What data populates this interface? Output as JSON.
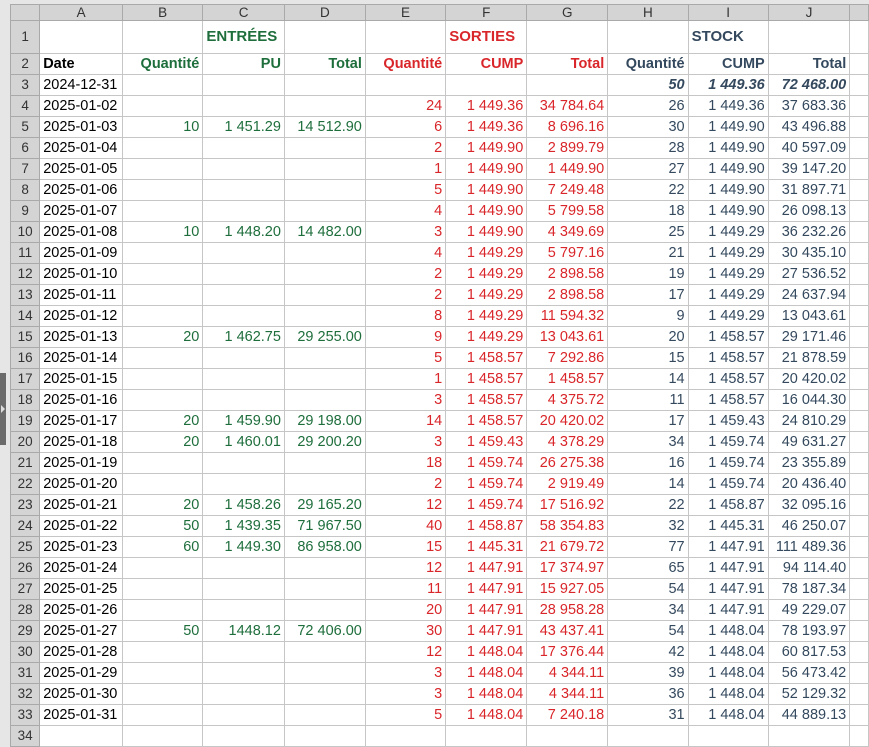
{
  "columns": [
    "A",
    "B",
    "C",
    "D",
    "E",
    "F",
    "G",
    "H",
    "I",
    "J",
    ""
  ],
  "colors": {
    "entrees": "#1e6e3c",
    "sorties": "#d9262a",
    "stock": "#34495e"
  },
  "sections": {
    "entrees": "ENTRÉES",
    "sorties": "SORTIES",
    "stock": "STOCK"
  },
  "headers": [
    "Date",
    "Quantité",
    "PU",
    "Total",
    "Quantité",
    "CUMP",
    "Total",
    "Quantité",
    "CUMP",
    "Total"
  ],
  "rows": [
    [
      "2024-12-31",
      "",
      "",
      "",
      "",
      "",
      "",
      "50",
      "1 449.36",
      "72 468.00"
    ],
    [
      "2025-01-02",
      "",
      "",
      "",
      "24",
      "1 449.36",
      "34 784.64",
      "26",
      "1 449.36",
      "37 683.36"
    ],
    [
      "2025-01-03",
      "10",
      "1 451.29",
      "14 512.90",
      "6",
      "1 449.36",
      "8 696.16",
      "30",
      "1 449.90",
      "43 496.88"
    ],
    [
      "2025-01-04",
      "",
      "",
      "",
      "2",
      "1 449.90",
      "2 899.79",
      "28",
      "1 449.90",
      "40 597.09"
    ],
    [
      "2025-01-05",
      "",
      "",
      "",
      "1",
      "1 449.90",
      "1 449.90",
      "27",
      "1 449.90",
      "39 147.20"
    ],
    [
      "2025-01-06",
      "",
      "",
      "",
      "5",
      "1 449.90",
      "7 249.48",
      "22",
      "1 449.90",
      "31 897.71"
    ],
    [
      "2025-01-07",
      "",
      "",
      "",
      "4",
      "1 449.90",
      "5 799.58",
      "18",
      "1 449.90",
      "26 098.13"
    ],
    [
      "2025-01-08",
      "10",
      "1 448.20",
      "14 482.00",
      "3",
      "1 449.90",
      "4 349.69",
      "25",
      "1 449.29",
      "36 232.26"
    ],
    [
      "2025-01-09",
      "",
      "",
      "",
      "4",
      "1 449.29",
      "5 797.16",
      "21",
      "1 449.29",
      "30 435.10"
    ],
    [
      "2025-01-10",
      "",
      "",
      "",
      "2",
      "1 449.29",
      "2 898.58",
      "19",
      "1 449.29",
      "27 536.52"
    ],
    [
      "2025-01-11",
      "",
      "",
      "",
      "2",
      "1 449.29",
      "2 898.58",
      "17",
      "1 449.29",
      "24 637.94"
    ],
    [
      "2025-01-12",
      "",
      "",
      "",
      "8",
      "1 449.29",
      "11 594.32",
      "9",
      "1 449.29",
      "13 043.61"
    ],
    [
      "2025-01-13",
      "20",
      "1 462.75",
      "29 255.00",
      "9",
      "1 449.29",
      "13 043.61",
      "20",
      "1 458.57",
      "29 171.46"
    ],
    [
      "2025-01-14",
      "",
      "",
      "",
      "5",
      "1 458.57",
      "7 292.86",
      "15",
      "1 458.57",
      "21 878.59"
    ],
    [
      "2025-01-15",
      "",
      "",
      "",
      "1",
      "1 458.57",
      "1 458.57",
      "14",
      "1 458.57",
      "20 420.02"
    ],
    [
      "2025-01-16",
      "",
      "",
      "",
      "3",
      "1 458.57",
      "4 375.72",
      "11",
      "1 458.57",
      "16 044.30"
    ],
    [
      "2025-01-17",
      "20",
      "1 459.90",
      "29 198.00",
      "14",
      "1 458.57",
      "20 420.02",
      "17",
      "1 459.43",
      "24 810.29"
    ],
    [
      "2025-01-18",
      "20",
      "1 460.01",
      "29 200.20",
      "3",
      "1 459.43",
      "4 378.29",
      "34",
      "1 459.74",
      "49 631.27"
    ],
    [
      "2025-01-19",
      "",
      "",
      "",
      "18",
      "1 459.74",
      "26 275.38",
      "16",
      "1 459.74",
      "23 355.89"
    ],
    [
      "2025-01-20",
      "",
      "",
      "",
      "2",
      "1 459.74",
      "2 919.49",
      "14",
      "1 459.74",
      "20 436.40"
    ],
    [
      "2025-01-21",
      "20",
      "1 458.26",
      "29 165.20",
      "12",
      "1 459.74",
      "17 516.92",
      "22",
      "1 458.87",
      "32 095.16"
    ],
    [
      "2025-01-22",
      "50",
      "1 439.35",
      "71 967.50",
      "40",
      "1 458.87",
      "58 354.83",
      "32",
      "1 445.31",
      "46 250.07"
    ],
    [
      "2025-01-23",
      "60",
      "1 449.30",
      "86 958.00",
      "15",
      "1 445.31",
      "21 679.72",
      "77",
      "1 447.91",
      "111 489.36"
    ],
    [
      "2025-01-24",
      "",
      "",
      "",
      "12",
      "1 447.91",
      "17 374.97",
      "65",
      "1 447.91",
      "94 114.40"
    ],
    [
      "2025-01-25",
      "",
      "",
      "",
      "11",
      "1 447.91",
      "15 927.05",
      "54",
      "1 447.91",
      "78 187.34"
    ],
    [
      "2025-01-26",
      "",
      "",
      "",
      "20",
      "1 447.91",
      "28 958.28",
      "34",
      "1 447.91",
      "49 229.07"
    ],
    [
      "2025-01-27",
      "50",
      "1448.12",
      "72 406.00",
      "30",
      "1 447.91",
      "43 437.41",
      "54",
      "1 448.04",
      "78 193.97"
    ],
    [
      "2025-01-28",
      "",
      "",
      "",
      "12",
      "1 448.04",
      "17 376.44",
      "42",
      "1 448.04",
      "60 817.53"
    ],
    [
      "2025-01-29",
      "",
      "",
      "",
      "3",
      "1 448.04",
      "4 344.11",
      "39",
      "1 448.04",
      "56 473.42"
    ],
    [
      "2025-01-30",
      "",
      "",
      "",
      "3",
      "1 448.04",
      "4 344.11",
      "36",
      "1 448.04",
      "52 129.32"
    ],
    [
      "2025-01-31",
      "",
      "",
      "",
      "5",
      "1 448.04",
      "7 240.18",
      "31",
      "1 448.04",
      "44 889.13"
    ]
  ]
}
